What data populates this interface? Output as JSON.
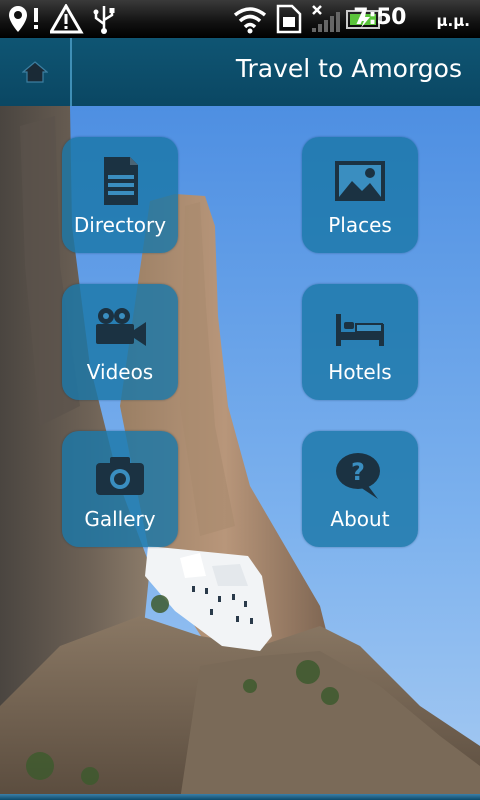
{
  "status_bar": {
    "time": "7:50",
    "ampm": "μ.μ.",
    "icons": [
      "location-alert-icon",
      "warning-icon",
      "usb-icon",
      "wifi-icon",
      "sim-icon",
      "no-signal-icon",
      "battery-charging-icon"
    ]
  },
  "header": {
    "title": "Travel to Amorgos",
    "home_icon": "home-icon"
  },
  "menu": {
    "items": [
      {
        "label": "Directory",
        "icon": "document-icon"
      },
      {
        "label": "Places",
        "icon": "picture-icon"
      },
      {
        "label": "Videos",
        "icon": "video-camera-icon"
      },
      {
        "label": "Hotels",
        "icon": "bed-icon"
      },
      {
        "label": "Gallery",
        "icon": "camera-icon"
      },
      {
        "label": "About",
        "icon": "question-bubble-icon"
      }
    ]
  },
  "colors": {
    "header_bg": "#0c4d6b",
    "tile_bg": "#1b78a8",
    "icon_dark": "#1b3242"
  }
}
